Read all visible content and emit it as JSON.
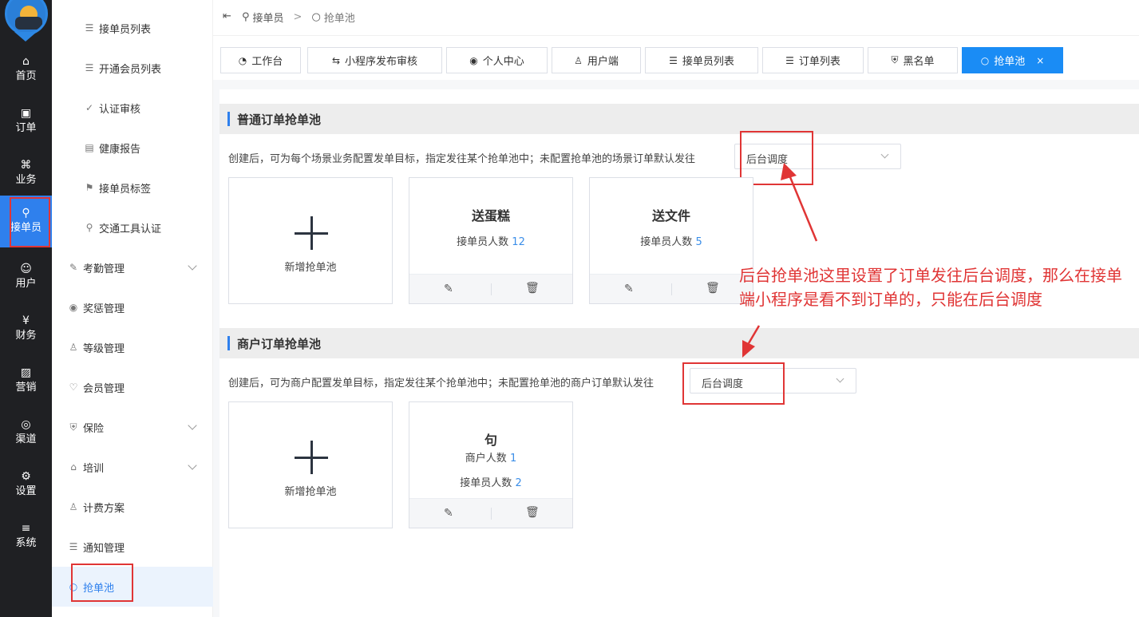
{
  "rail": {
    "items": [
      {
        "label": "首页",
        "icon": "home-icon",
        "glyph": "⌂"
      },
      {
        "label": "订单",
        "icon": "order-icon",
        "glyph": "▣"
      },
      {
        "label": "业务",
        "icon": "business-icon",
        "glyph": "⌘"
      },
      {
        "label": "接单员",
        "icon": "bike-icon",
        "glyph": "⚲"
      },
      {
        "label": "用户",
        "icon": "user-icon",
        "glyph": "☺"
      },
      {
        "label": "财务",
        "icon": "finance-icon",
        "glyph": "¥"
      },
      {
        "label": "营销",
        "icon": "chart-icon",
        "glyph": "▨"
      },
      {
        "label": "渠道",
        "icon": "compass-icon",
        "glyph": "◎"
      },
      {
        "label": "设置",
        "icon": "settings-icon",
        "glyph": "⚙"
      },
      {
        "label": "系统",
        "icon": "sliders-icon",
        "glyph": "≡"
      }
    ],
    "active_index": 3
  },
  "submenu": {
    "items": [
      {
        "label": "接单员列表",
        "glyph": "☰"
      },
      {
        "label": "开通会员列表",
        "glyph": "☰"
      },
      {
        "label": "认证审核",
        "glyph": "✓"
      },
      {
        "label": "健康报告",
        "glyph": "▤"
      },
      {
        "label": "接单员标签",
        "glyph": "⚑"
      },
      {
        "label": "交通工具认证",
        "glyph": "⚲"
      },
      {
        "label": "考勤管理",
        "glyph": "✎"
      },
      {
        "label": "奖惩管理",
        "glyph": "◉"
      },
      {
        "label": "等级管理",
        "glyph": "♙"
      },
      {
        "label": "会员管理",
        "glyph": "♡"
      },
      {
        "label": "保险",
        "glyph": "⛨"
      },
      {
        "label": "培训",
        "glyph": "⌂"
      },
      {
        "label": "计费方案",
        "glyph": "♙"
      },
      {
        "label": "通知管理",
        "glyph": "☰"
      },
      {
        "label": "抢单池",
        "glyph": "○"
      }
    ]
  },
  "breadcrumb": {
    "parent": "接单员",
    "separator": ">",
    "current": "抢单池"
  },
  "tabs": [
    {
      "label": "工作台",
      "glyph": "◔"
    },
    {
      "label": "小程序发布审核",
      "glyph": "⇆"
    },
    {
      "label": "个人中心",
      "glyph": "◉"
    },
    {
      "label": "用户端",
      "glyph": "♙"
    },
    {
      "label": "接单员列表",
      "glyph": "☰"
    },
    {
      "label": "订单列表",
      "glyph": "☰"
    },
    {
      "label": "黑名单",
      "glyph": "⛨"
    },
    {
      "label": "抢单池",
      "glyph": "○",
      "close": "×"
    }
  ],
  "sections": {
    "normal": {
      "title": "普通订单抢单池",
      "desc": "创建后，可为每个场景业务配置发单目标，指定发往某个抢单池中；未配置抢单池的场景订单默认发往",
      "select_value": "后台调度",
      "add_label": "新增抢单池",
      "cards": [
        {
          "name": "送蛋糕",
          "stat_label": "接单员人数",
          "stat_value": "12"
        },
        {
          "name": "送文件",
          "stat_label": "接单员人数",
          "stat_value": "5"
        }
      ]
    },
    "merchant": {
      "title": "商户订单抢单池",
      "desc": "创建后，可为商户配置发单目标，指定发往某个抢单池中；未配置抢单池的商户订单默认发往",
      "select_value": "后台调度",
      "add_label": "新增抢单池",
      "cards": [
        {
          "name": "句",
          "stat1_label": "商户人数",
          "stat1_value": "1",
          "stat2_label": "接单员人数",
          "stat2_value": "2"
        }
      ]
    }
  },
  "annotation": "后台抢单池这里设置了订单发往后台调度，那么在接单端小程序是看不到订单的，只能在后台调度",
  "colors": {
    "accent": "#1a8cf5",
    "annotation": "#e03535",
    "rail": "#1f2023"
  }
}
